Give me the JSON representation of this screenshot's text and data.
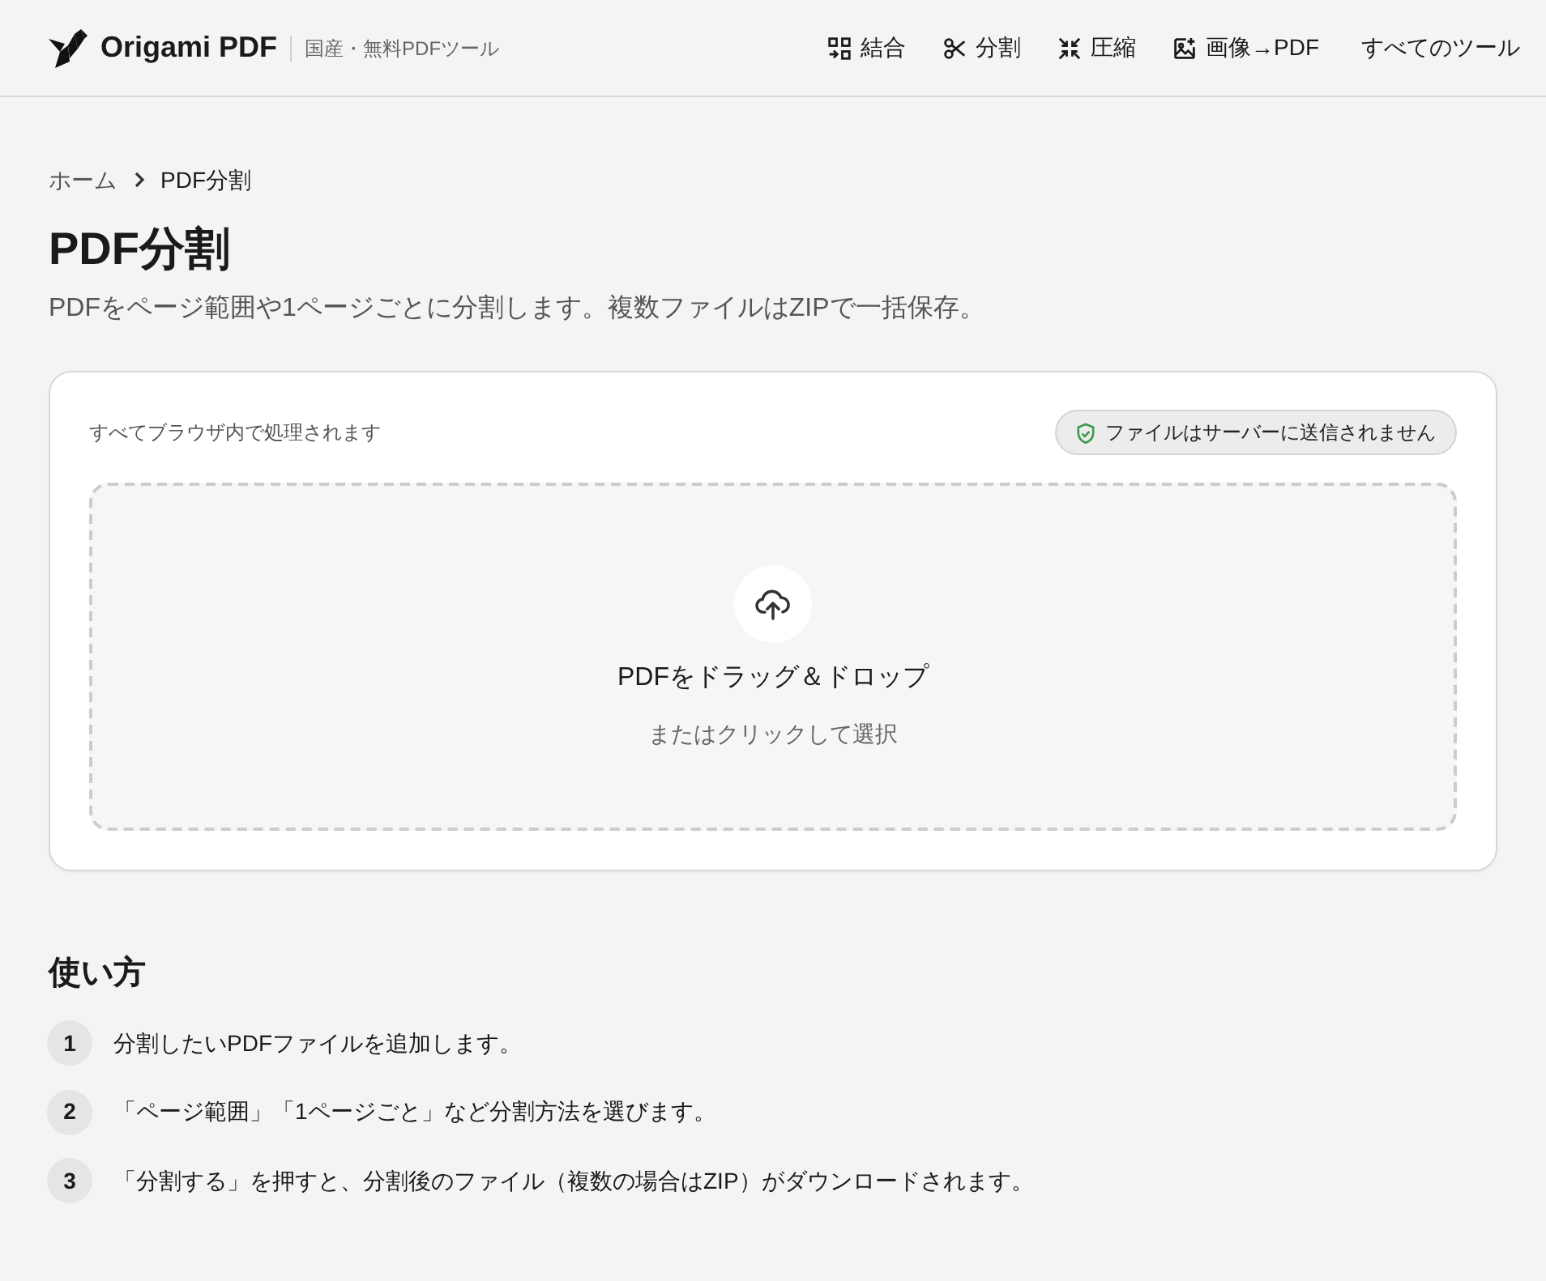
{
  "header": {
    "brand": "Origami PDF",
    "tagline": "国産・無料PDFツール",
    "nav": [
      {
        "label": "結合",
        "kind": "icon"
      },
      {
        "label": "分割",
        "kind": "icon"
      },
      {
        "label": "圧縮",
        "kind": "icon"
      },
      {
        "label": "画像→PDF",
        "kind": "icon"
      },
      {
        "label": "すべてのツール",
        "kind": "plain"
      }
    ]
  },
  "breadcrumb": [
    {
      "label": "ホーム",
      "selected": false
    },
    {
      "label": "PDF分割",
      "selected": true
    }
  ],
  "page": {
    "title": "PDF分割",
    "description": "PDFをページ範囲や1ページごとに分割します。複数ファイルはZIPで一括保存。"
  },
  "upload_card": {
    "note": "すべてブラウザ内で処理されます",
    "badge": "ファイルはサーバーに送信されません",
    "dropzone": {
      "title": "PDFをドラッグ＆ドロップ",
      "subtitle": "またはクリックして選択"
    }
  },
  "how_to": {
    "heading": "使い方",
    "steps": [
      {
        "number": "1",
        "text": "分割したいPDFファイルを追加します。"
      },
      {
        "number": "2",
        "text": "「ページ範囲」「1ページごと」など分割方法を選びます。"
      },
      {
        "number": "3",
        "text": "「分割する」を押すと、分割後のファイル（複数の場合はZIP）がダウンロードされます。"
      }
    ]
  }
}
